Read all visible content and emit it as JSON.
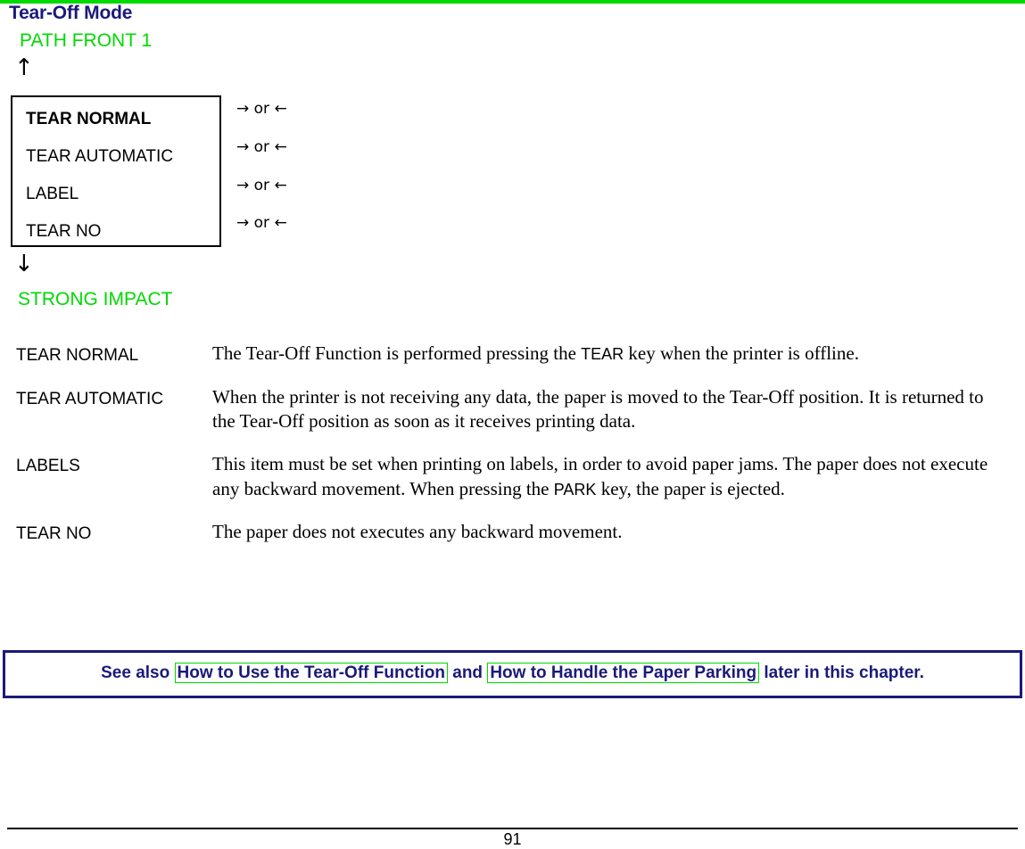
{
  "page": {
    "title": "Tear-Off Mode",
    "title_color": "#1a1a7a",
    "accent_green": "#00d900",
    "page_number": "91"
  },
  "flow_diagram": {
    "top_label": "PATH FRONT 1",
    "arrow_up": "↑",
    "arrow_down": "↓",
    "bottom_label": "STRONG IMPACT",
    "menu_items": [
      {
        "label": "TEAR NORMAL",
        "selected": true,
        "key_hint": "→ or ←"
      },
      {
        "label": "TEAR AUTOMATIC",
        "selected": false,
        "key_hint": "→ or ←"
      },
      {
        "label": "LABEL",
        "selected": false,
        "key_hint": "→ or ←"
      },
      {
        "label": "TEAR NO",
        "selected": false,
        "key_hint": "→ or ←"
      }
    ]
  },
  "definitions": [
    {
      "term": "TEAR NORMAL",
      "desc_pre": "The Tear-Off Function is performed pressing the ",
      "keycap": "TEAR",
      "desc_post": " key when the printer is offline.",
      "keycap2": "",
      "desc_post2": ""
    },
    {
      "term": "TEAR AUTOMATIC",
      "desc_pre": "When the printer is not receiving any data, the paper is moved to the Tear-Off position. It is returned to the Tear-Off position as soon as it receives printing data.",
      "keycap": "",
      "desc_post": "",
      "keycap2": "",
      "desc_post2": ""
    },
    {
      "term": "LABELS",
      "desc_pre": "This item must be set when printing on labels, in order to avoid paper jams. The paper does not execute any backward movement. When pressing the ",
      "keycap": "PARK",
      "desc_post": " key, the paper is ejected.",
      "keycap2": "",
      "desc_post2": ""
    },
    {
      "term": "TEAR NO",
      "desc_pre": "The paper does not executes any backward movement.",
      "keycap": "",
      "desc_post": "",
      "keycap2": "",
      "desc_post2": ""
    }
  ],
  "see_also": {
    "prefix": "See also ",
    "link1": "How to Use the Tear-Off Function",
    "middle": " and ",
    "link2": "How to Handle the Paper Parking",
    "suffix": " later in this chapter.",
    "link_border_color": "#00d900",
    "box_border_color": "#1a1a7a"
  }
}
